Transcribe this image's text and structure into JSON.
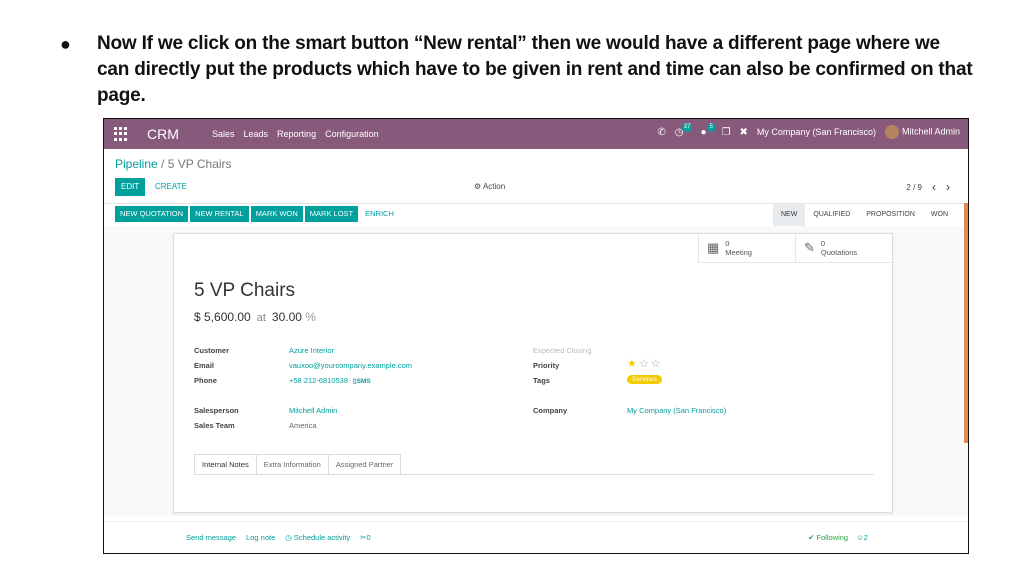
{
  "slide": {
    "bullet": "●",
    "text": "Now If we click on the smart button “New rental” then we would have a different page where we can directly put the products which have to be given in rent and time can also be confirmed on that page."
  },
  "navbar": {
    "brand": "CRM",
    "menu": [
      "Sales",
      "Leads",
      "Reporting",
      "Configuration"
    ],
    "badge_activities": "37",
    "badge_messages": "5",
    "company": "My Company (San Francisco)",
    "user": "Mitchell Admin",
    "icons": [
      "phone-icon",
      "activity-icon",
      "chat-icon",
      "gift-icon",
      "close-icon"
    ]
  },
  "control": {
    "breadcrumb_parent": "Pipeline",
    "breadcrumb_sep": "/",
    "breadcrumb_current": "5 VP Chairs",
    "edit_label": "EDIT",
    "create_label": "CREATE",
    "action_label": "Action",
    "pager": "2 / 9"
  },
  "statusbar": {
    "buttons": [
      "NEW QUOTATION",
      "NEW RENTAL",
      "MARK WON",
      "MARK LOST",
      "ENRICH"
    ],
    "stages": [
      "NEW",
      "QUALIFIED",
      "PROPOSITION",
      "WON"
    ],
    "active_stage": "NEW"
  },
  "smart_buttons": {
    "meeting_count": "0",
    "meeting_label": "Meeting",
    "quotations_count": "0",
    "quotations_label": "Quotations"
  },
  "record": {
    "title": "5 VP Chairs",
    "revenue": "$ 5,600.00",
    "at": "at",
    "probability": "30.00",
    "pct": "%",
    "labels": {
      "customer": "Customer",
      "email": "Email",
      "phone": "Phone",
      "salesperson": "Salesperson",
      "sales_team": "Sales Team",
      "expected_closing": "Expected Closing",
      "priority": "Priority",
      "tags": "Tags",
      "company": "Company"
    },
    "customer": "Azure Interior",
    "email": "vauxoo@yourcompany.example.com",
    "phone": "+58 212-6810538",
    "sms": "SMS",
    "salesperson": "Mitchell Admin",
    "sales_team": "America",
    "priority_stars": 1,
    "priority_max": 3,
    "tag": "Services",
    "company": "My Company (San Francisco)"
  },
  "tabs": [
    "Internal Notes",
    "Extra Information",
    "Assigned Partner"
  ],
  "chatter": {
    "send_message": "Send message",
    "log_note": "Log note",
    "schedule_activity": "Schedule activity",
    "attachments": "0",
    "following": "Following",
    "followers": "2"
  },
  "colors": {
    "navbar": "#875a7b",
    "primary": "#00a09d",
    "tag": "#f3cc00"
  }
}
